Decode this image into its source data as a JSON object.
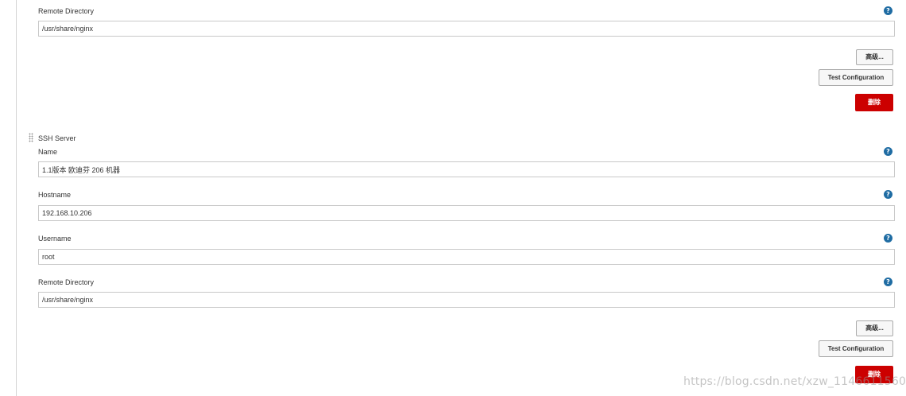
{
  "server1": {
    "remote_directory_label": "Remote Directory",
    "remote_directory_value": "/usr/share/nginx",
    "advanced_label": "高级...",
    "test_label": "Test Configuration",
    "delete_label": "删除"
  },
  "server2": {
    "section_title": "SSH Server",
    "name_label": "Name",
    "name_value": "1.1版本 欧迪芬 206 机器",
    "hostname_label": "Hostname",
    "hostname_value": "192.168.10.206",
    "username_label": "Username",
    "username_value": "root",
    "remote_directory_label": "Remote Directory",
    "remote_directory_value": "/usr/share/nginx",
    "advanced_label": "高级...",
    "test_label": "Test Configuration",
    "delete_label": "删除"
  },
  "help_glyph": "?",
  "watermark": "https://blog.csdn.net/xzw_1146611560",
  "colors": {
    "help_icon": "#1f6ca3",
    "delete_button": "#cc0000",
    "field_border": "#c8c8c8"
  }
}
